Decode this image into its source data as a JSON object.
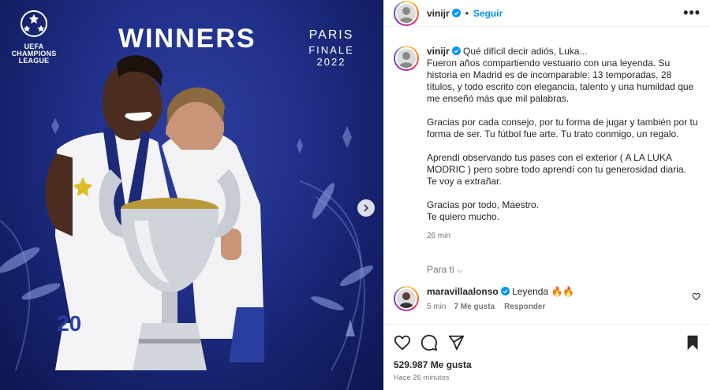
{
  "photo": {
    "logo_line1": "UEFA",
    "logo_line2": "CHAMPIONS",
    "logo_line3": "LEAGUE",
    "banner": "WINNERS",
    "city": "PARIS",
    "event": "FINALE 2022",
    "jersey_number": "20"
  },
  "header": {
    "username": "vinijr",
    "follow_label": "Seguir",
    "more_label": "•••"
  },
  "caption": {
    "username": "vinijr",
    "paragraphs": [
      "Qué difícil decir adiós, Luka...\nFueron años compartiendo vestuario con una leyenda. Su historia en Madrid es de incomparable: 13 temporadas, 28 títulos, y todo escrito con elegancia, talento y una humildad que me enseñó más que mil palabras.",
      "Gracias por cada consejo, por tu forma de jugar y también por tu forma de ser. Tu fútbol fue arte. Tu trato conmigo, un regalo.",
      "Aprendí observando tus pases con el exterior ( A LA LUKA MODRIC ) pero sobre todo aprendí con tu generosidad diaria.\nTe voy a extrañar.",
      "Gracias por todo, Maestro.\nTe quiero mucho."
    ],
    "time": "26 min"
  },
  "para_ti": "Para ti",
  "comment": {
    "username": "maravillaalonso",
    "text": "Leyenda 🔥🔥",
    "time": "5 min",
    "likes": "7 Me gusta",
    "reply": "Responder"
  },
  "footer": {
    "likes": "529.987 Me gusta",
    "ago": "Hace 26 minutos"
  },
  "colors": {
    "accent": "#0095f6",
    "verified": "#0095f6",
    "photo_bg": "#20308a",
    "muted": "#737373"
  },
  "icons": [
    "ucl-starball-icon",
    "next-arrow-icon",
    "verified-icon",
    "more-icon",
    "heart-icon",
    "comment-icon",
    "share-icon",
    "bookmark-icon",
    "chevron-down-icon"
  ]
}
